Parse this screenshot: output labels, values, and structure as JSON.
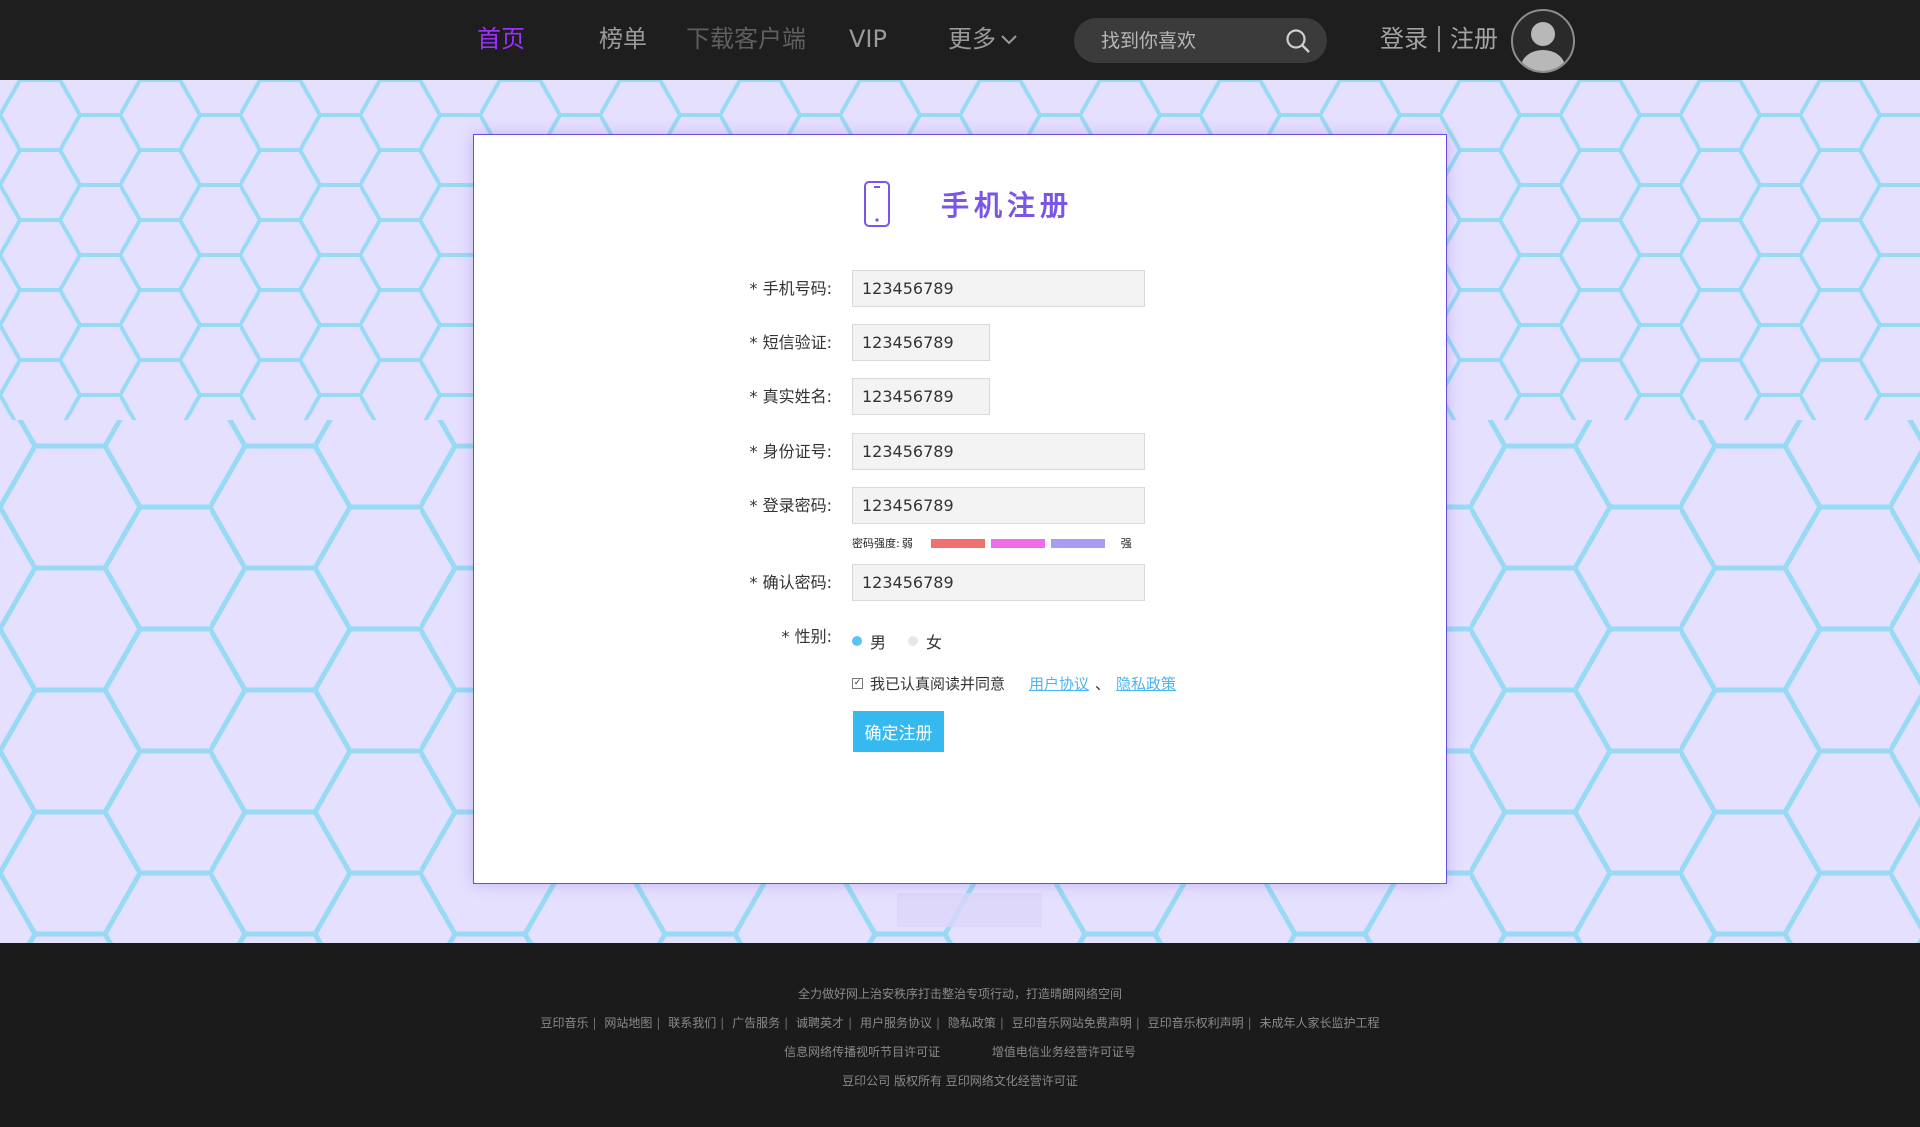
{
  "nav": {
    "items": [
      {
        "label": "首页",
        "state": "active"
      },
      {
        "label": "榜单",
        "state": "normal"
      },
      {
        "label": "下载客户端",
        "state": "dim"
      },
      {
        "label": "VIP",
        "state": "normal"
      },
      {
        "label": "更多",
        "state": "normal",
        "icon": "chevron-down-icon"
      }
    ],
    "search_placeholder": "找到你喜欢",
    "login": "登录",
    "register": "注册"
  },
  "form": {
    "title": "手机注册",
    "fields": {
      "phone": {
        "label": "* 手机号码:",
        "value": "123456789"
      },
      "sms": {
        "label": "* 短信验证:",
        "value": "123456789"
      },
      "realname": {
        "label": "* 真实姓名:",
        "value": "123456789"
      },
      "idcard": {
        "label": "* 身份证号:",
        "value": "123456789"
      },
      "password": {
        "label": "* 登录密码:",
        "value": "123456789"
      },
      "confirm": {
        "label": "* 确认密码:",
        "value": "123456789"
      }
    },
    "strength": {
      "label": "密码强度:",
      "weak": "弱",
      "strong": "强",
      "colors": [
        "#f07070",
        "#f06de8",
        "#a99cf4"
      ]
    },
    "gender": {
      "label": "* 性别:",
      "male": "男",
      "female": "女",
      "selected": "男"
    },
    "agree": {
      "checked": true,
      "text": "我已认真阅读并同意",
      "terms": "用户协议",
      "sep": "、",
      "privacy": "隐私政策"
    },
    "submit": "确定注册"
  },
  "footer": {
    "slogan": "全力做好网上治安秩序打击整治专项行动，打造晴朗网络空间",
    "links": [
      "豆印音乐",
      "网站地图",
      "联系我们",
      "广告服务",
      "诚聘英才",
      "用户服务协议",
      "隐私政策",
      "豆印音乐网站免费声明",
      "豆印音乐权利声明",
      "未成年人家长监护工程"
    ],
    "license_a": "信息网络传播视听节目许可证",
    "license_b": "增值电信业务经营许可证号",
    "copyright": "豆印公司 版权所有 豆印网络文化经营许可证"
  },
  "colors": {
    "accent": "#9b30ff",
    "title": "#7a55e8",
    "button": "#35b9ef",
    "link": "#4ab6f0",
    "radio_on": "#5cc4f0"
  }
}
